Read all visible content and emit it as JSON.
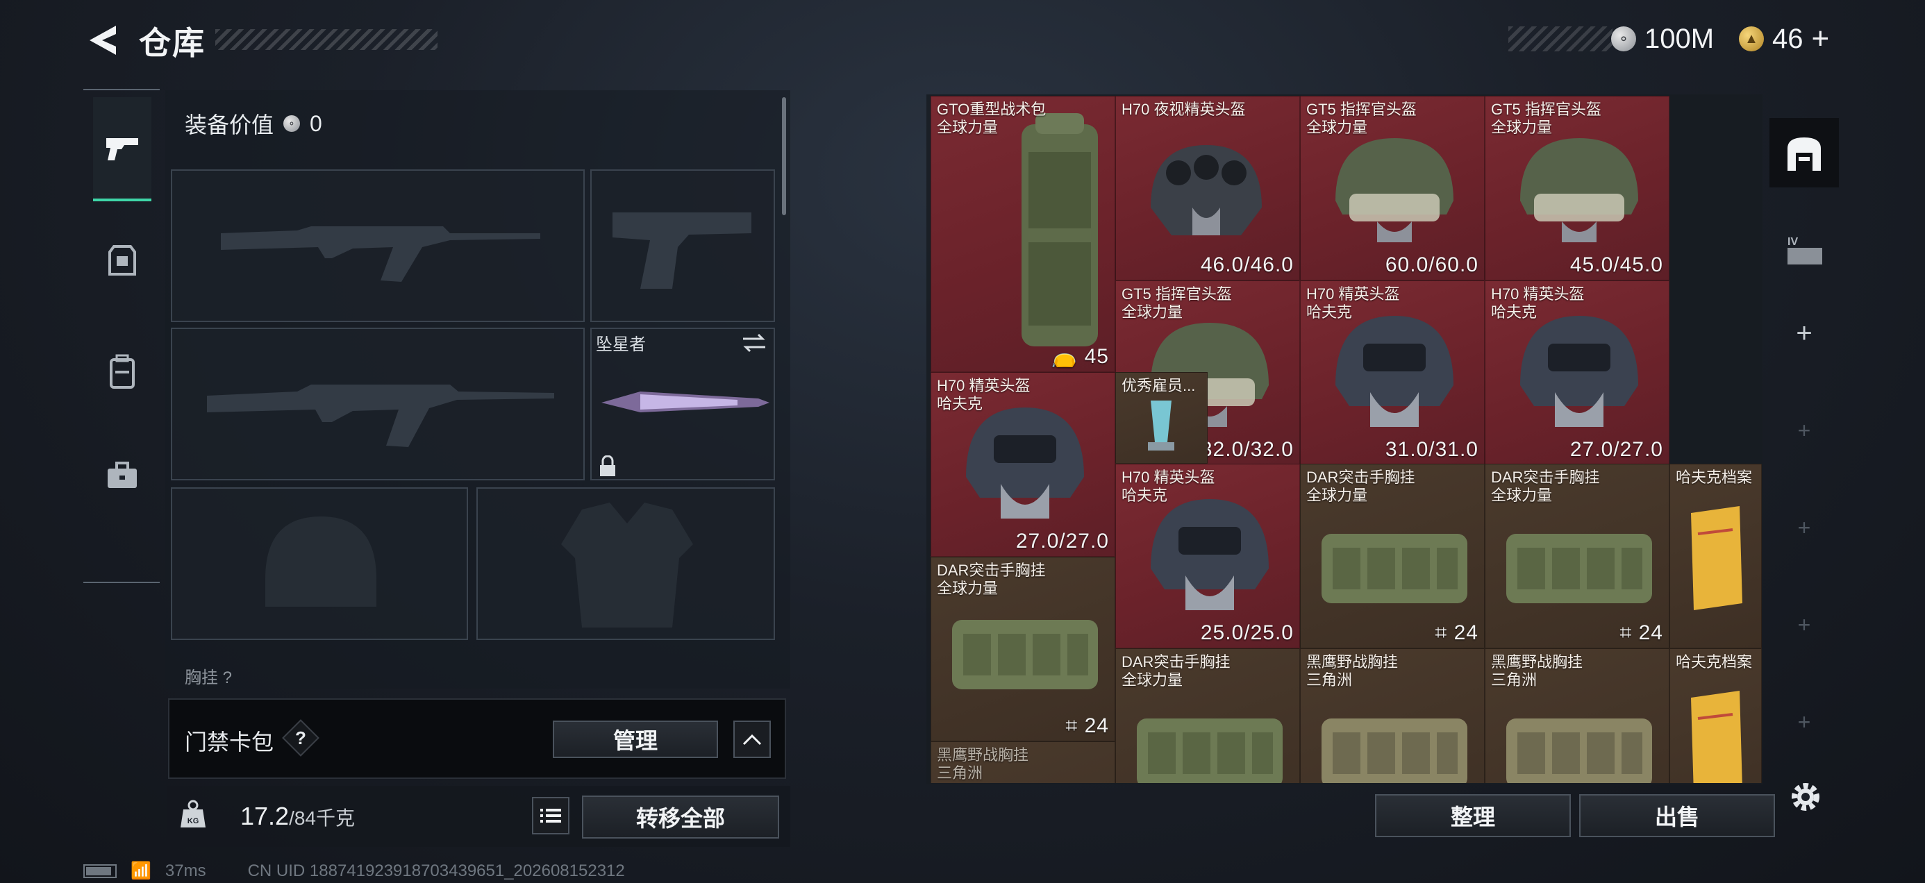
{
  "header": {
    "title": "仓库"
  },
  "currency": {
    "silver": "100M",
    "gold": "46",
    "gold_add": "+"
  },
  "equip": {
    "value_label": "装备价值",
    "value": "0",
    "knife_name": "坠星者",
    "partial_slot_label": "胸挂",
    "partial_slot_q": "?"
  },
  "card_bag": {
    "label": "门禁卡包",
    "help": "?",
    "manage": "管理"
  },
  "weight": {
    "current": "17.2",
    "max_unit": "/84千克",
    "transfer_all": "转移全部"
  },
  "stash": {
    "items": [
      {
        "name": "GTO重型战术包",
        "sub": "全球力量",
        "value": "45"
      },
      {
        "name": "H70 夜视精英头盔",
        "sub": "",
        "value": "46.0/46.0"
      },
      {
        "name": "GT5 指挥官头盔",
        "sub": "全球力量",
        "value": "60.0/60.0"
      },
      {
        "name": "GT5 指挥官头盔",
        "sub": "全球力量",
        "value": "45.0/45.0"
      },
      {
        "name": "GT5 指挥官头盔",
        "sub": "全球力量",
        "value": "32.0/32.0"
      },
      {
        "name": "H70 精英头盔",
        "sub": "哈夫克",
        "value": "31.0/31.0"
      },
      {
        "name": "H70 精英头盔",
        "sub": "哈夫克",
        "value": "27.0/27.0"
      },
      {
        "name": "H70 精英头盔",
        "sub": "哈夫克",
        "value": "27.0/27.0"
      },
      {
        "name": "优秀雇员...",
        "sub": "",
        "value": ""
      },
      {
        "name": "H70 精英头盔",
        "sub": "哈夫克",
        "value": "25.0/25.0"
      },
      {
        "name": "DAR突击手胸挂",
        "sub": "全球力量",
        "value": "24"
      },
      {
        "name": "DAR突击手胸挂",
        "sub": "全球力量",
        "value": "24"
      },
      {
        "name": "哈夫克档案",
        "sub": "",
        "value": ""
      },
      {
        "name": "DAR突击手胸挂",
        "sub": "全球力量",
        "value": "24"
      },
      {
        "name": "DAR突击手胸挂",
        "sub": "全球力量",
        "value": ""
      },
      {
        "name": "黑鹰野战胸挂",
        "sub": "三角洲",
        "value": ""
      },
      {
        "name": "黑鹰野战胸挂",
        "sub": "三角洲",
        "value": ""
      },
      {
        "name": "哈夫克档案",
        "sub": "",
        "value": ""
      },
      {
        "name": "黑鹰野战胸挂",
        "sub": "三角洲",
        "value": ""
      }
    ],
    "sort": "整理",
    "sell": "出售"
  },
  "status": {
    "ping": "37ms",
    "uid": "CN UID 18874192391870343965­1_202608152312"
  },
  "colors": {
    "accent": "#3fd6a8",
    "item_red": "#6a222a",
    "item_brown": "#3d2f24"
  },
  "icons": {
    "back": "chevron-left-icon",
    "gear": "gear-icon",
    "lock": "lock-icon",
    "swap": "swap-icon",
    "weight": "weight-icon",
    "list": "list-icon"
  }
}
